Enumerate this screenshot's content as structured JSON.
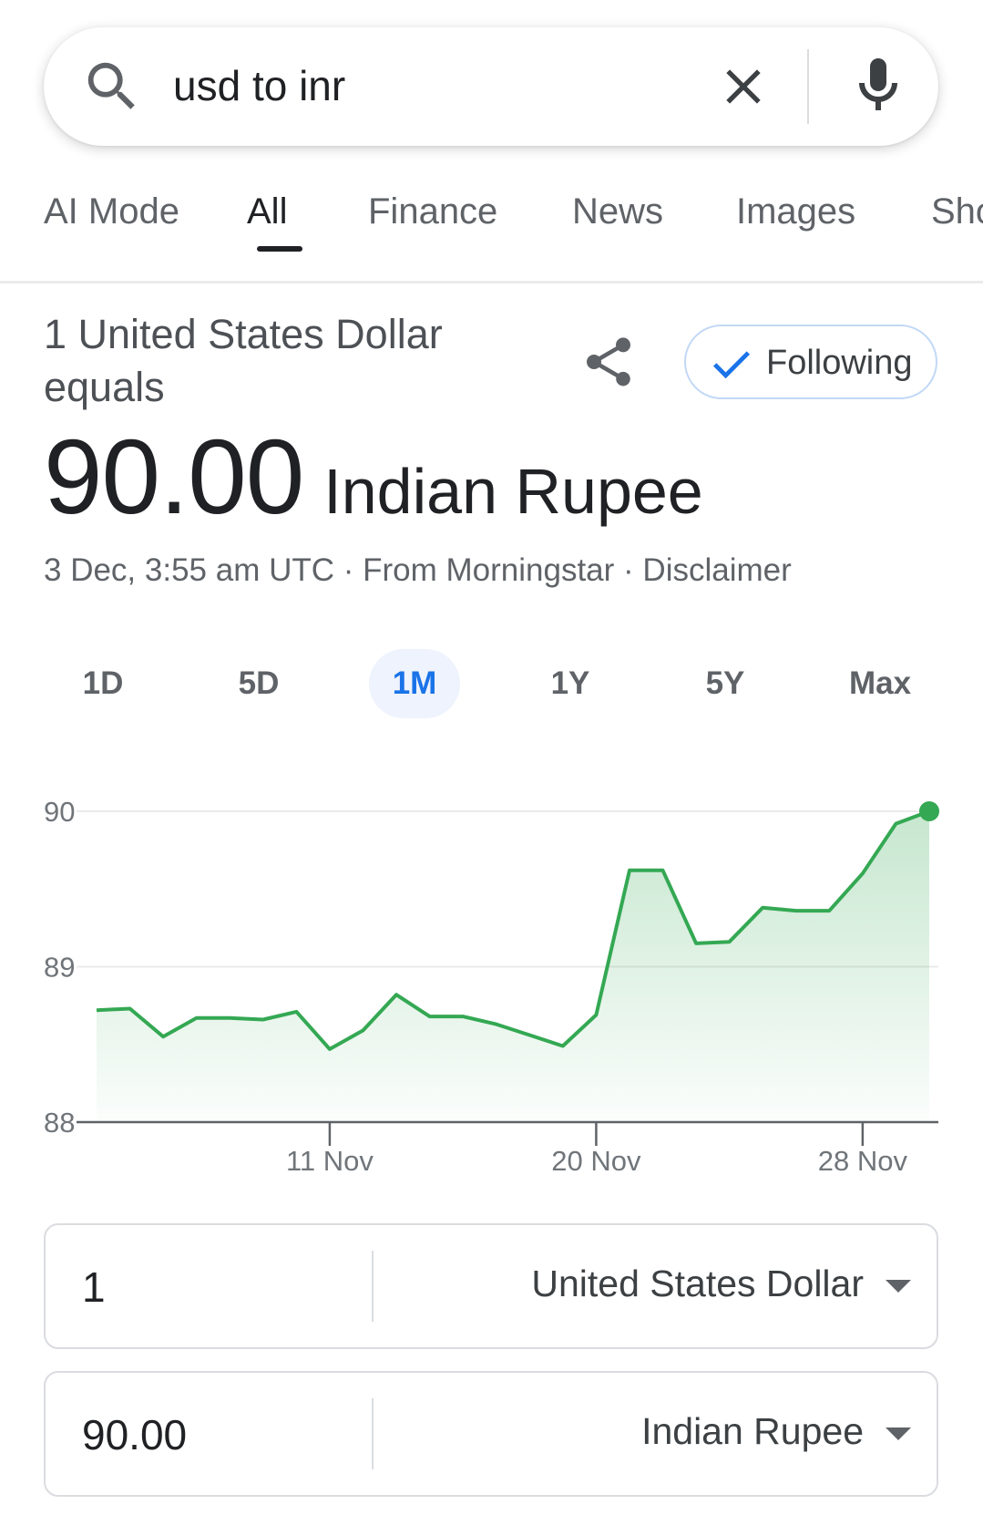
{
  "search": {
    "query": "usd to inr"
  },
  "tabs": [
    {
      "label": "AI Mode",
      "active": false
    },
    {
      "label": "All",
      "active": true
    },
    {
      "label": "Finance",
      "active": false
    },
    {
      "label": "News",
      "active": false
    },
    {
      "label": "Images",
      "active": false
    },
    {
      "label": "Sho",
      "active": false
    }
  ],
  "converter": {
    "equals_text": "1 United States Dollar equals",
    "rate_value": "90.00",
    "rate_unit": "Indian Rupee",
    "follow_label": "Following",
    "timestamp": "3 Dec, 3:55 am UTC",
    "source": "From Morningstar",
    "dot": "·",
    "disclaimer": "Disclaimer",
    "from": {
      "amount": "1",
      "currency": "United States Dollar"
    },
    "to": {
      "amount": "90.00",
      "currency": "Indian Rupee"
    }
  },
  "ranges": [
    {
      "label": "1D",
      "active": false
    },
    {
      "label": "5D",
      "active": false
    },
    {
      "label": "1M",
      "active": true
    },
    {
      "label": "1Y",
      "active": false
    },
    {
      "label": "5Y",
      "active": false
    },
    {
      "label": "Max",
      "active": false
    }
  ],
  "colors": {
    "accent": "#1a73e8",
    "line": "#34a853",
    "fill": "#34a853",
    "text": "#202124"
  },
  "chart_data": {
    "type": "area",
    "ylim": [
      88,
      90
    ],
    "yticks": [
      "90",
      "89",
      "88"
    ],
    "xtick_labels": [
      {
        "label": "11 Nov",
        "index": 7
      },
      {
        "label": "20 Nov",
        "index": 15
      },
      {
        "label": "28 Nov",
        "index": 23
      }
    ],
    "values": [
      88.72,
      88.73,
      88.55,
      88.67,
      88.67,
      88.66,
      88.71,
      88.47,
      88.59,
      88.82,
      88.68,
      88.68,
      88.63,
      88.56,
      88.49,
      88.69,
      89.62,
      89.62,
      89.15,
      89.16,
      89.38,
      89.36,
      89.36,
      89.6,
      89.92,
      90.0
    ],
    "grid": true,
    "last_point_marker": true
  }
}
